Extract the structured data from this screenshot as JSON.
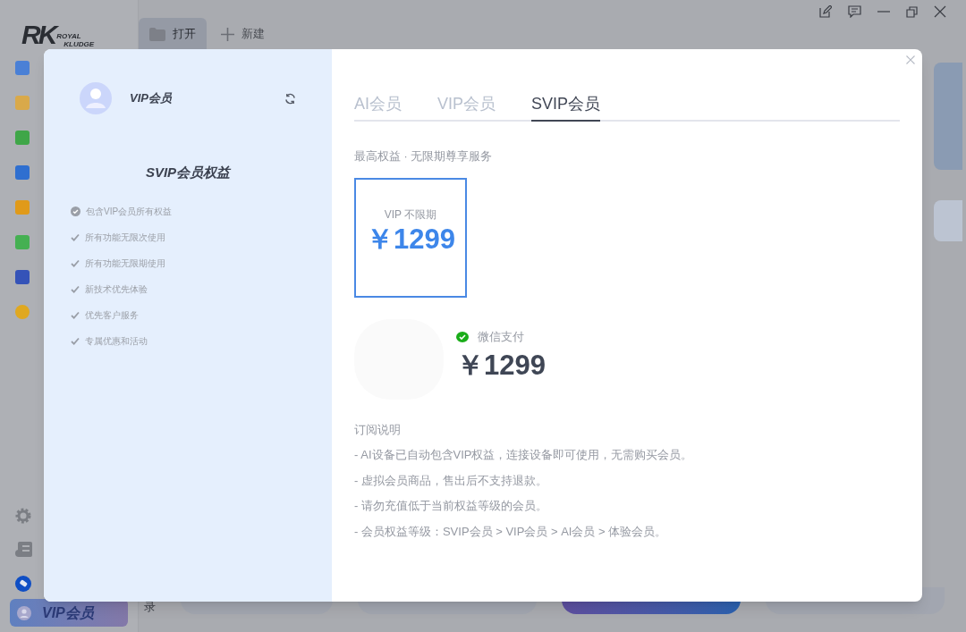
{
  "app": {
    "logo": {
      "main": "RK",
      "line_1": "ROYAL",
      "line_2": "KLUDGE"
    },
    "toolbar": [
      {
        "label": "打开",
        "kind": "folder",
        "selected": true
      },
      {
        "label": "新建",
        "kind": "plus",
        "selected": false
      }
    ],
    "sidebar": {
      "items": [
        {
          "color": "#4a80d6"
        },
        {
          "color": "#d9a94a"
        },
        {
          "color": "#3fa648"
        },
        {
          "color": "#2f6fd0"
        },
        {
          "color": "#e09a1a"
        },
        {
          "color": "#45b052"
        },
        {
          "color": "#3553b8"
        },
        {
          "color": "#e0a820"
        }
      ],
      "vip_button": "VIP会员"
    },
    "bottom_label": "录"
  },
  "modal": {
    "profile": {
      "name": "VIP会员"
    },
    "benefits_title": "SVIP会员权益",
    "benefits": [
      {
        "kind": "circle-check",
        "text": "包含VIP会员所有权益"
      },
      {
        "kind": "check",
        "text": "所有功能无限次使用"
      },
      {
        "kind": "check",
        "text": "所有功能无限期使用"
      },
      {
        "kind": "check",
        "text": "新技术优先体验"
      },
      {
        "kind": "check",
        "text": "优先客户服务"
      },
      {
        "kind": "check",
        "text": "专属优惠和活动"
      }
    ],
    "tabs": [
      {
        "label": "AI会员",
        "selected": false
      },
      {
        "label": "VIP会员",
        "selected": false
      },
      {
        "label": "SVIP会员",
        "selected": true
      }
    ],
    "subtitle": "最高权益 · 无限期尊享服务",
    "plans": [
      {
        "name": "VIP 不限期",
        "price": "￥1299",
        "selected": true
      }
    ],
    "payment": {
      "method": "微信支付",
      "price": "￥1299"
    },
    "notes": {
      "title": "订阅说明",
      "items": [
        "- AI设备已自动包含VIP权益，连接设备即可使用，无需购买会员。",
        "- 虚拟会员商品，售出后不支持退款。",
        "- 请勿充值低于当前权益等级的会员。",
        "- 会员权益等级：SVIP会员 > VIP会员 > AI会员 > 体验会员。"
      ]
    }
  }
}
